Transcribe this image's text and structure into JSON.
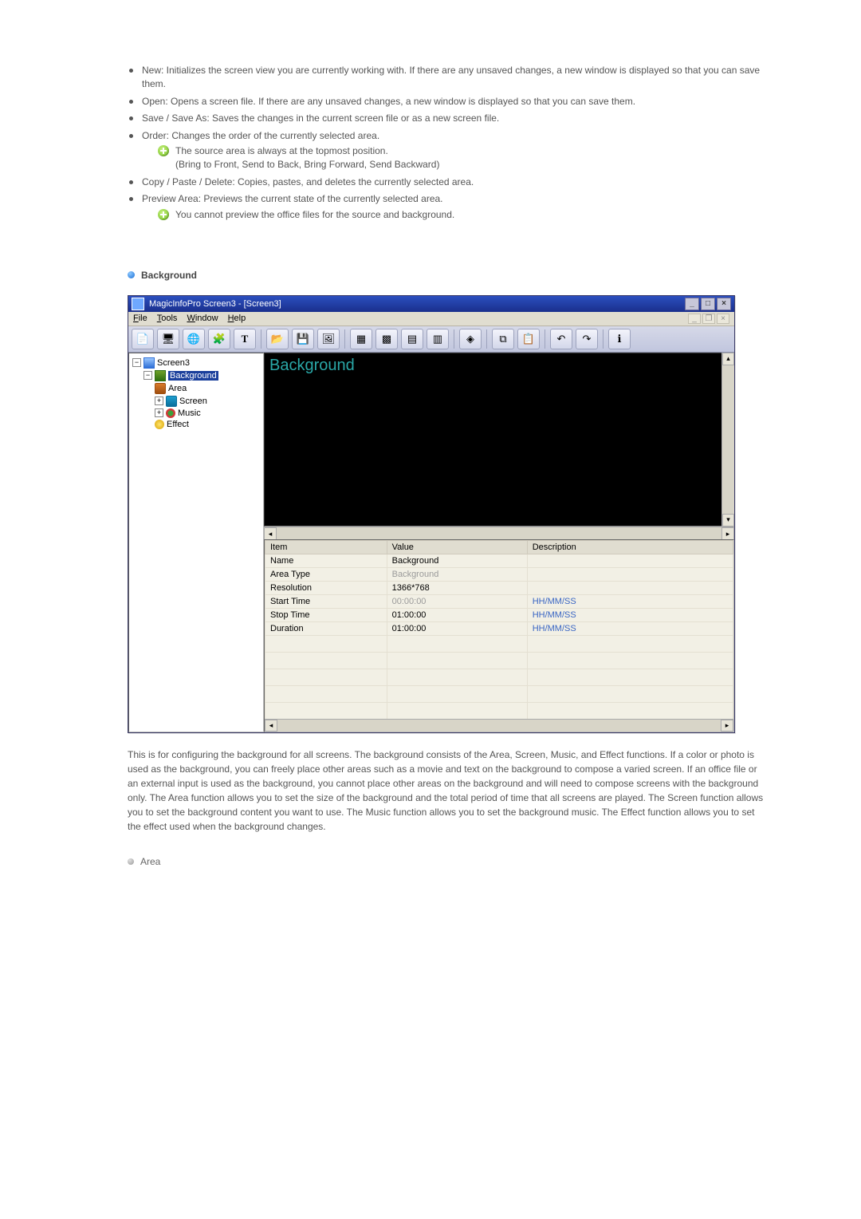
{
  "top_list": [
    {
      "text": "New: Initializes the screen view you are currently working with. If there are any unsaved changes, a new window is displayed so that you can save them."
    },
    {
      "text": "Open: Opens a screen file. If there are any unsaved changes, a new window is displayed so that you can save them."
    },
    {
      "text": "Save / Save As: Saves the changes in the current screen file or as a new screen file."
    },
    {
      "text": "Order: Changes the order of the currently selected area.",
      "notes": [
        "The source area is always at the topmost position.",
        "(Bring to Front, Send to Back, Bring Forward, Send Backward)"
      ]
    },
    {
      "text": "Copy / Paste / Delete: Copies, pastes, and deletes the currently selected area."
    },
    {
      "text": "Preview Area: Previews the current state of the currently selected area.",
      "notes": [
        "You cannot preview the office files for the source and background."
      ]
    }
  ],
  "section_title": "Background",
  "app": {
    "title": "MagicInfoPro Screen3 - [Screen3]",
    "menus": [
      "File",
      "Tools",
      "Window",
      "Help"
    ],
    "canvas_label": "Background",
    "tree": {
      "root": "Screen3",
      "selected": "Background",
      "children": [
        "Area",
        "Screen",
        "Music",
        "Effect"
      ]
    },
    "table": {
      "headers": [
        "Item",
        "Value",
        "Description"
      ],
      "rows": [
        {
          "item": "Name",
          "value": "Background",
          "desc": "",
          "value_dim": false
        },
        {
          "item": "Area Type",
          "value": "Background",
          "desc": "",
          "value_dim": true
        },
        {
          "item": "Resolution",
          "value": "1366*768",
          "desc": "",
          "value_dim": false
        },
        {
          "item": "Start Time",
          "value": "00:00:00",
          "desc": "HH/MM/SS",
          "value_dim": true,
          "desc_blue": true
        },
        {
          "item": "Stop Time",
          "value": "01:00:00",
          "desc": "HH/MM/SS",
          "value_dim": false,
          "desc_blue": true
        },
        {
          "item": "Duration",
          "value": "01:00:00",
          "desc": "HH/MM/SS",
          "value_dim": false,
          "desc_blue": true
        }
      ]
    }
  },
  "body_para": "This is for configuring the background for all screens. The background consists of the Area, Screen, Music, and Effect functions. If a color or photo is used as the background, you can freely place other areas such as a movie and text on the background to compose a varied screen. If an office file or an external input is used as the background, you cannot place other areas on the background and will need to compose screens with the background only. The Area function allows you to set the size of the background and the total period of time that all screens are played. The Screen function allows you to set the background content you want to use. The Music function allows you to set the background music. The Effect function allows you to set the effect used when the background changes.",
  "sub_title": "Area"
}
